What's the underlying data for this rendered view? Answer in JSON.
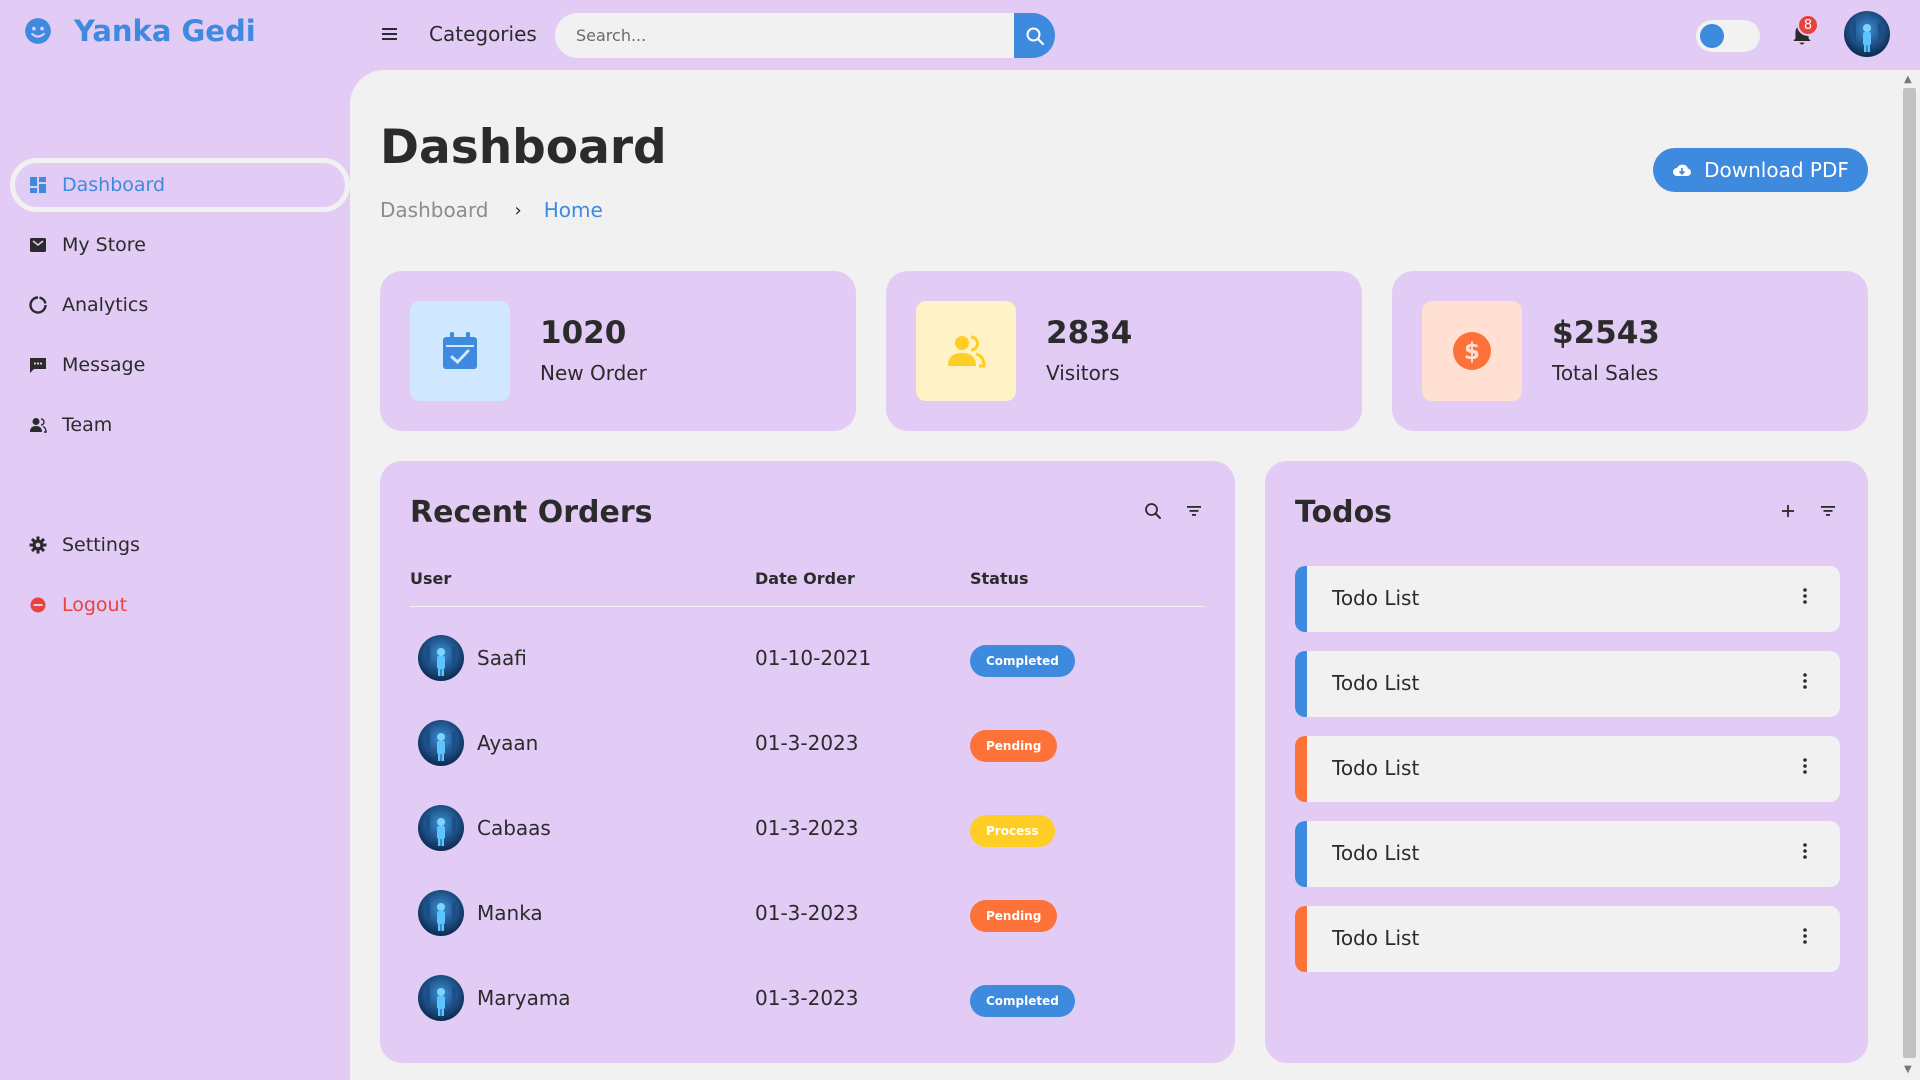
{
  "app": {
    "brand": "Yanka Gedi"
  },
  "topbar": {
    "categories_label": "Categories",
    "search_placeholder": "Search...",
    "notification_count": "8"
  },
  "sidebar": {
    "items": [
      {
        "label": "Dashboard",
        "icon": "dashboard-icon",
        "active": true
      },
      {
        "label": "My Store",
        "icon": "store-icon"
      },
      {
        "label": "Analytics",
        "icon": "analytics-icon"
      },
      {
        "label": "Message",
        "icon": "message-icon"
      },
      {
        "label": "Team",
        "icon": "team-icon"
      }
    ],
    "settings": "Settings",
    "logout": "Logout"
  },
  "page": {
    "title": "Dashboard",
    "breadcrumb": [
      "Dashboard",
      "Home"
    ],
    "download_label": "Download PDF"
  },
  "stats": [
    {
      "value": "1020",
      "label": "New Order",
      "icon": "calendar-check-icon",
      "color": "#3d8ade",
      "bg": "#cfe8ff"
    },
    {
      "value": "2834",
      "label": "Visitors",
      "icon": "people-icon",
      "color": "#ffce26",
      "bg": "#fff2c6"
    },
    {
      "value": "$2543",
      "label": "Total Sales",
      "icon": "dollar-circle-icon",
      "color": "#fd7238",
      "bg": "#ffe0d3"
    }
  ],
  "orders": {
    "title": "Recent Orders",
    "columns": [
      "User",
      "Date Order",
      "Status"
    ],
    "rows": [
      {
        "user": "Saafi",
        "date": "01-10-2021",
        "status": "Completed",
        "status_color": "#3d8ade"
      },
      {
        "user": "Ayaan",
        "date": "01-3-2023",
        "status": "Pending",
        "status_color": "#fd7238"
      },
      {
        "user": "Cabaas",
        "date": "01-3-2023",
        "status": "Process",
        "status_color": "#ffce26"
      },
      {
        "user": "Manka",
        "date": "01-3-2023",
        "status": "Pending",
        "status_color": "#fd7238"
      },
      {
        "user": "Maryama",
        "date": "01-3-2023",
        "status": "Completed",
        "status_color": "#3d8ade"
      }
    ]
  },
  "todos": {
    "title": "Todos",
    "items": [
      {
        "text": "Todo List",
        "color": "#3d8ade"
      },
      {
        "text": "Todo List",
        "color": "#3d8ade"
      },
      {
        "text": "Todo List",
        "color": "#fd7238"
      },
      {
        "text": "Todo List",
        "color": "#3d8ade"
      },
      {
        "text": "Todo List",
        "color": "#fd7238"
      }
    ]
  },
  "colors": {
    "accent": "#3d8ade",
    "sidebar_bg": "#e2cbf5",
    "main_bg": "#f1f1f1",
    "danger": "#e8433c",
    "orange": "#fd7238",
    "yellow": "#ffce26"
  }
}
